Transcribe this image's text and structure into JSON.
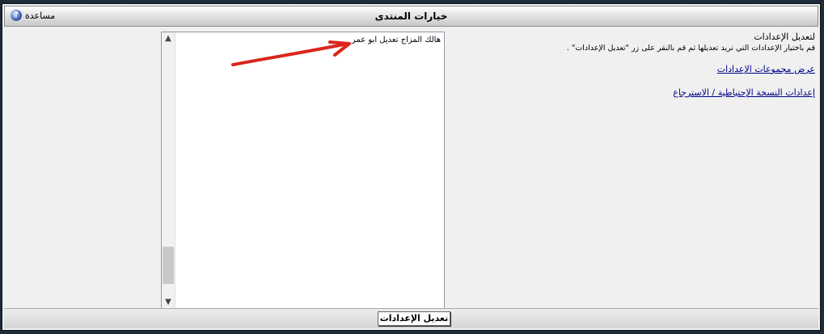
{
  "header": {
    "title": "خيارات المنتدى",
    "help_label": "مساعدة",
    "help_icon_glyph": "?"
  },
  "listbox": {
    "options": [
      "هالك المزاج تعديل ابو عمر"
    ]
  },
  "sidebar": {
    "title": "لتعديل الإعدادات",
    "description": "قم باختيار الإعدادات التي تريد تعديلها ثم قم بالنقر على زر \"تعديل الإعدادات\" .",
    "links": [
      {
        "label": "عرض مجموعات الإعدادات"
      },
      {
        "label": "إعدادات النسخة الإحتياطية / الاسترجاع"
      }
    ]
  },
  "footer": {
    "save_label": "تعديل الإعدادات"
  },
  "colors": {
    "annotation_arrow": "#d9261c",
    "link": "#00008b"
  }
}
